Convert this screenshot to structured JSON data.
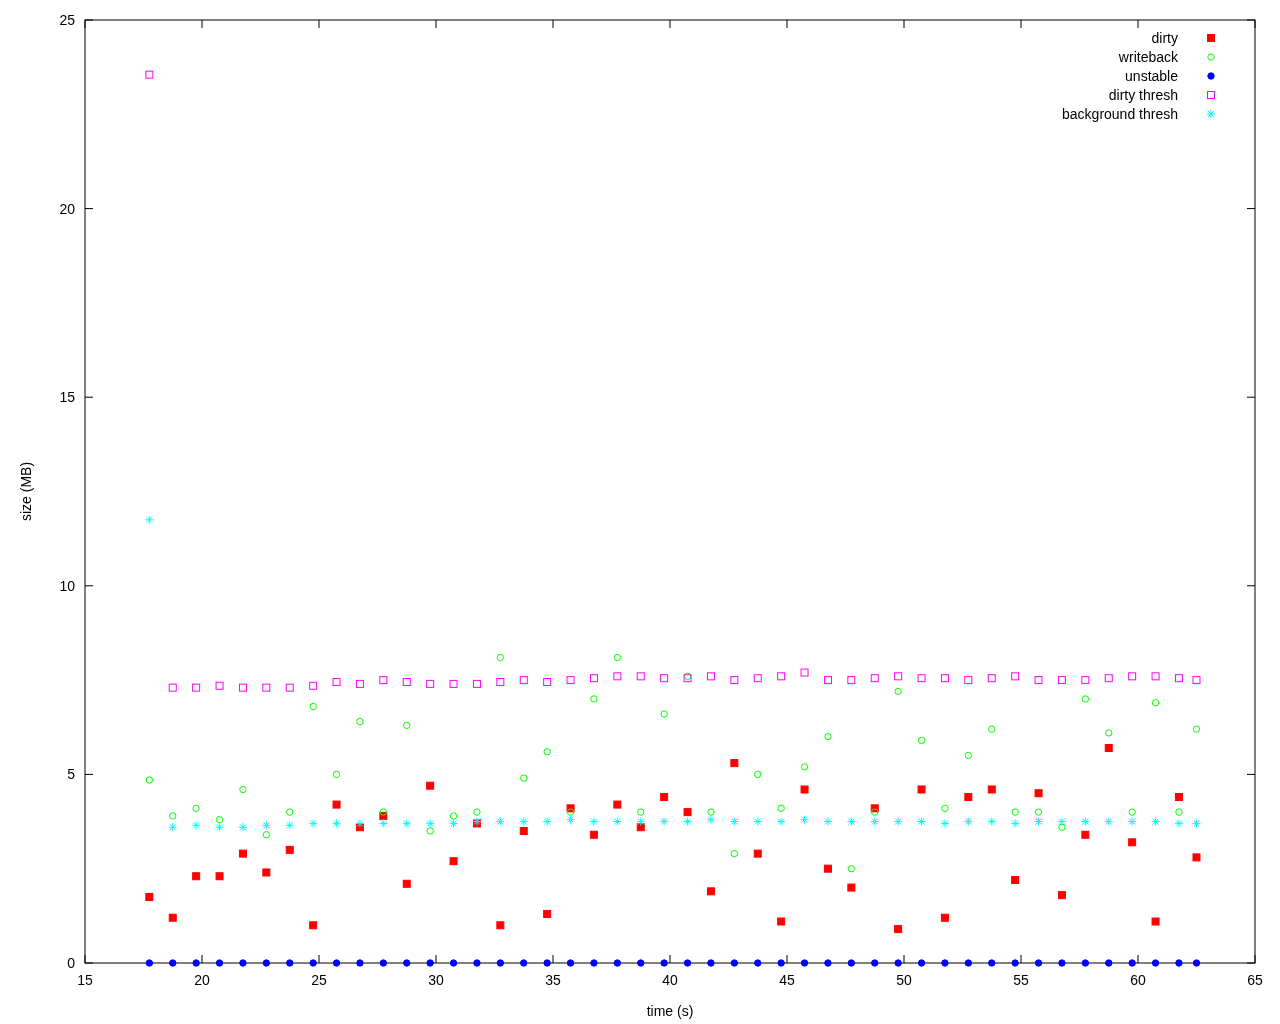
{
  "chart_data": {
    "type": "scatter",
    "xlabel": "time (s)",
    "ylabel": "size (MB)",
    "xlim": [
      15,
      65
    ],
    "ylim": [
      0,
      25
    ],
    "xticks": [
      15,
      20,
      25,
      30,
      35,
      40,
      45,
      50,
      55,
      60,
      65
    ],
    "yticks": [
      0,
      5,
      10,
      15,
      20,
      25
    ],
    "legend": true,
    "x": [
      17.75,
      18.75,
      19.75,
      20.75,
      21.75,
      22.75,
      23.75,
      24.75,
      25.75,
      26.75,
      27.75,
      28.75,
      29.75,
      30.75,
      31.75,
      32.75,
      33.75,
      34.75,
      35.75,
      36.75,
      37.75,
      38.75,
      39.75,
      40.75,
      41.75,
      42.75,
      43.75,
      44.75,
      45.75,
      46.75,
      47.75,
      48.75,
      49.75,
      50.75,
      51.75,
      52.75,
      53.75,
      54.75,
      55.75,
      56.75,
      57.75,
      58.75,
      59.75,
      60.75,
      61.75,
      62.5
    ],
    "series": [
      {
        "name": "dirty",
        "color": "#ff0000",
        "marker": "square",
        "values": [
          1.75,
          1.2,
          2.3,
          2.3,
          2.9,
          2.4,
          3.0,
          1.0,
          4.2,
          3.6,
          3.9,
          2.1,
          4.7,
          2.7,
          3.7,
          1.0,
          3.5,
          1.3,
          4.1,
          3.4,
          4.2,
          3.6,
          4.4,
          4.0,
          1.9,
          5.3,
          2.9,
          1.1,
          4.6,
          2.5,
          2.0,
          4.1,
          0.9,
          4.6,
          1.2,
          4.4,
          4.6,
          2.2,
          4.5,
          1.8,
          3.4,
          5.7,
          3.2,
          1.1,
          4.4,
          2.8
        ]
      },
      {
        "name": "writeback",
        "color": "#00ff00",
        "marker": "circle",
        "values": [
          4.85,
          3.9,
          4.1,
          3.8,
          4.6,
          3.4,
          4.0,
          6.8,
          5.0,
          6.4,
          4.0,
          6.3,
          3.5,
          3.9,
          4.0,
          8.1,
          4.9,
          5.6,
          4.0,
          7.0,
          8.1,
          4.0,
          6.6,
          7.6,
          4.0,
          2.9,
          5.0,
          4.1,
          5.2,
          6.0,
          2.5,
          4.0,
          7.2,
          5.9,
          4.1,
          5.5,
          6.2,
          4.0,
          4.0,
          3.6,
          7.0,
          6.1,
          4.0,
          6.9,
          4.0,
          6.2
        ]
      },
      {
        "name": "unstable",
        "color": "#0000ff",
        "marker": "circle",
        "values": [
          0,
          0,
          0,
          0,
          0,
          0,
          0,
          0,
          0,
          0,
          0,
          0,
          0,
          0,
          0,
          0,
          0,
          0,
          0,
          0,
          0,
          0,
          0,
          0,
          0,
          0,
          0,
          0,
          0,
          0,
          0,
          0,
          0,
          0,
          0,
          0,
          0,
          0,
          0,
          0,
          0,
          0,
          0,
          0,
          0,
          0
        ]
      },
      {
        "name": "dirty thresh",
        "color": "#ff00ff",
        "marker": "square",
        "values": [
          23.55,
          7.3,
          7.3,
          7.35,
          7.3,
          7.3,
          7.3,
          7.35,
          7.45,
          7.4,
          7.5,
          7.45,
          7.4,
          7.4,
          7.4,
          7.45,
          7.5,
          7.45,
          7.5,
          7.55,
          7.6,
          7.6,
          7.55,
          7.55,
          7.6,
          7.5,
          7.55,
          7.6,
          7.7,
          7.5,
          7.5,
          7.55,
          7.6,
          7.55,
          7.55,
          7.5,
          7.55,
          7.6,
          7.5,
          7.5,
          7.5,
          7.55,
          7.6,
          7.6,
          7.55,
          7.5
        ]
      },
      {
        "name": "background thresh",
        "color": "#00ffff",
        "marker": "cross",
        "values": [
          11.75,
          3.6,
          3.65,
          3.6,
          3.6,
          3.65,
          3.65,
          3.7,
          3.7,
          3.7,
          3.7,
          3.7,
          3.7,
          3.7,
          3.75,
          3.75,
          3.75,
          3.75,
          3.8,
          3.75,
          3.75,
          3.75,
          3.75,
          3.75,
          3.8,
          3.75,
          3.75,
          3.75,
          3.8,
          3.75,
          3.75,
          3.75,
          3.75,
          3.75,
          3.7,
          3.75,
          3.75,
          3.7,
          3.75,
          3.75,
          3.75,
          3.75,
          3.75,
          3.75,
          3.7,
          3.7
        ]
      }
    ]
  }
}
